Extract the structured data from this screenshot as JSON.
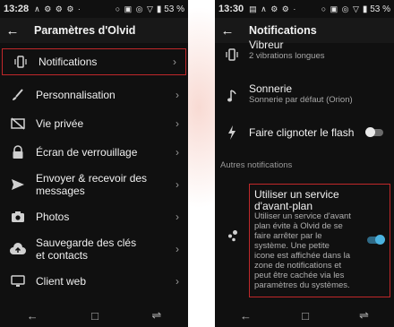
{
  "left": {
    "status": {
      "time": "13:28",
      "notif_icons": "∧ ⚙ ⚙ ⚙ ·",
      "sys_icons": "○ ▣ ◎ ▽",
      "battery": "▮ 53 %"
    },
    "title": "Paramètres d'Olvid",
    "items": [
      {
        "label": "Notifications",
        "icon": "vibration-icon"
      },
      {
        "label": "Personnalisation",
        "icon": "brush-icon"
      },
      {
        "label": "Vie privée",
        "icon": "private-icon"
      },
      {
        "label": "Écran de verrouillage",
        "icon": "lock-icon"
      },
      {
        "label": "Envoyer & recevoir des messages",
        "icon": "send-icon"
      },
      {
        "label": "Photos",
        "icon": "camera-icon"
      },
      {
        "label": "Sauvegarde des clés et contacts",
        "icon": "cloud-upload-icon"
      },
      {
        "label": "Client web",
        "icon": "monitor-icon"
      }
    ]
  },
  "right": {
    "status": {
      "time": "13:30",
      "notif_icons": "▤ ∧ ⚙ ⚙ ·",
      "sys_icons": "○ ▣ ◎ ▽",
      "battery": "▮ 53 %"
    },
    "title": "Notifications",
    "vibrate": {
      "title": "Vibreur",
      "sub": "2 vibrations longues"
    },
    "ringtone": {
      "title": "Sonnerie",
      "sub": "Sonnerie par défaut (Orion)"
    },
    "flash": {
      "title": "Faire clignoter le flash"
    },
    "other_header": "Autres notifications",
    "foreground": {
      "title": "Utiliser un service d'avant-plan",
      "desc": "Utiliser un service d'avant plan évite à Olvid de se faire arrêter par le système. Une petite icone est affichée dans la zone de notifications et peut être cachée via les paramètres du systèmes."
    }
  },
  "colors": {
    "highlight": "#c0282a",
    "toggle_on": "#4bb3e0",
    "background": "#101010"
  }
}
